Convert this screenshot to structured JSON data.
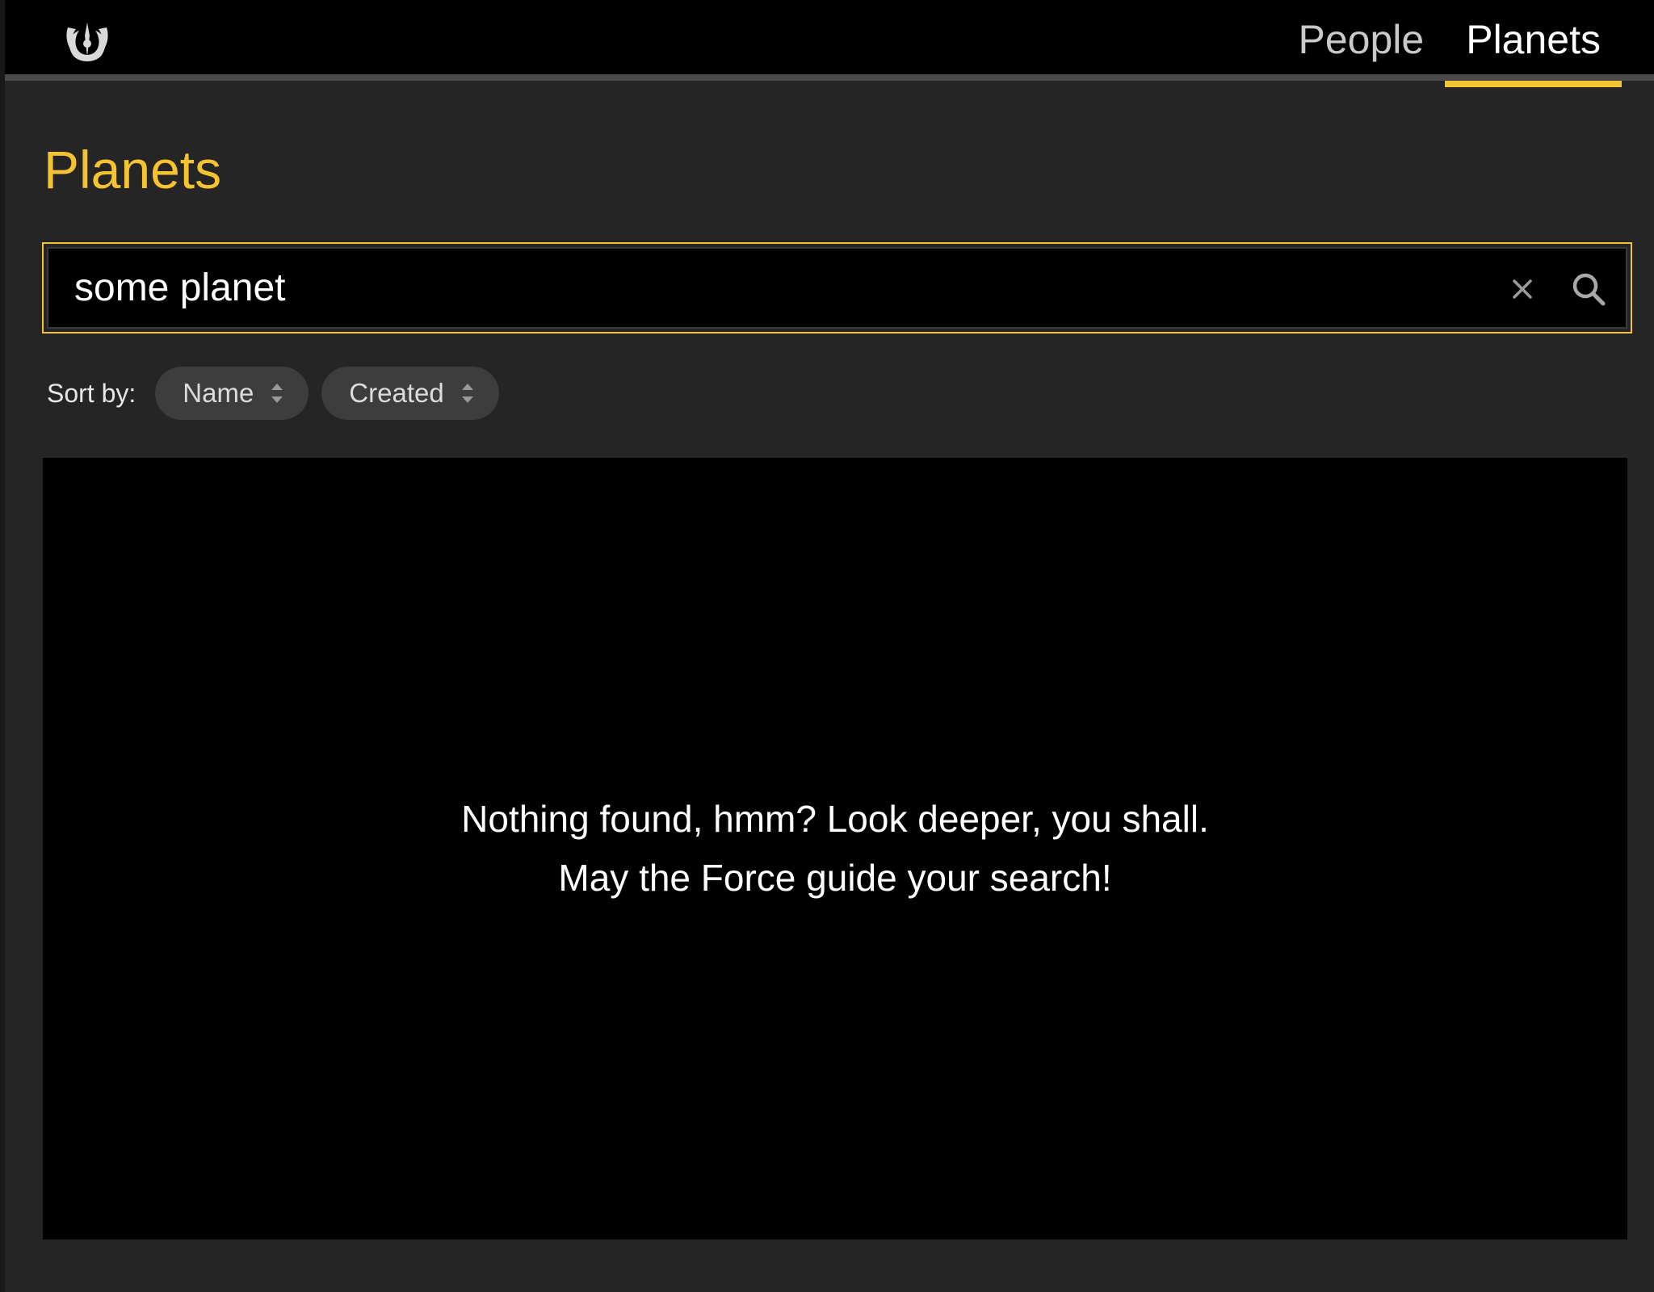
{
  "nav": {
    "logo_icon": "jedi-order-icon",
    "items": [
      {
        "label": "People",
        "active": false
      },
      {
        "label": "Planets",
        "active": true
      }
    ]
  },
  "page": {
    "title": "Planets"
  },
  "search": {
    "value": "some planet",
    "clear_icon": "close-icon",
    "search_icon": "search-icon"
  },
  "sort": {
    "label": "Sort by:",
    "options": [
      {
        "label": "Name",
        "icon": "sort-icon"
      },
      {
        "label": "Created",
        "icon": "sort-icon"
      }
    ]
  },
  "results": {
    "empty_line_1": "Nothing found, hmm? Look deeper, you shall.",
    "empty_line_2": "May the Force guide your search!"
  },
  "colors": {
    "accent": "#f5c232",
    "background": "#252525",
    "panel": "#000000"
  }
}
